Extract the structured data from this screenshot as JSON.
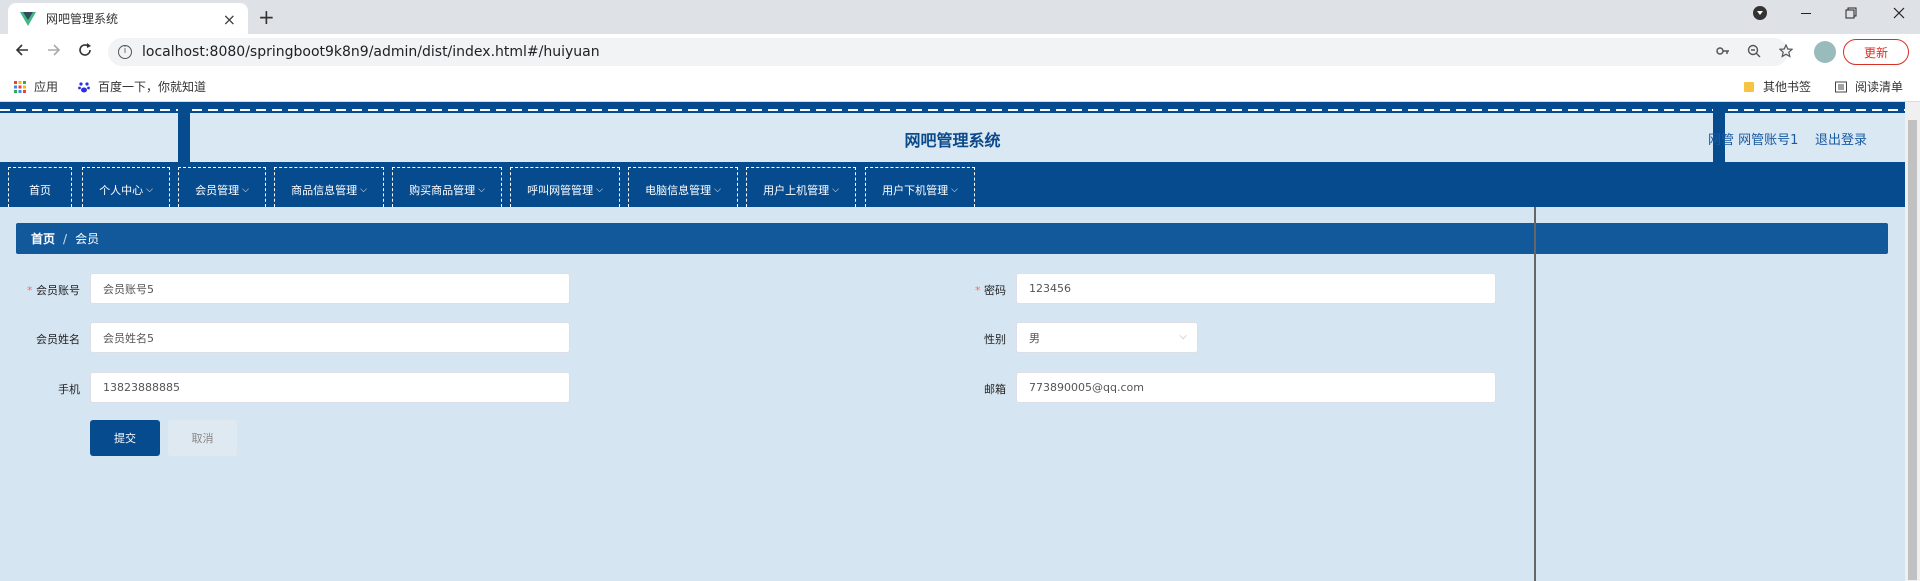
{
  "browser": {
    "tab_title": "网吧管理系统",
    "tab_close": "×",
    "new_tab": "+",
    "url": "localhost:8080/springboot9k8n9/admin/dist/index.html#/huiyuan",
    "update_label": "更新",
    "bookmarks": {
      "apps": "应用",
      "baidu": "百度一下，你就知道",
      "other": "其他书签",
      "reading": "阅读清单"
    }
  },
  "header": {
    "title": "网吧管理系统",
    "account": "网管 网管账号1",
    "logout": "退出登录"
  },
  "menu": [
    {
      "label": "首页",
      "dropdown": false
    },
    {
      "label": "个人中心",
      "dropdown": true
    },
    {
      "label": "会员管理",
      "dropdown": true
    },
    {
      "label": "商品信息管理",
      "dropdown": true
    },
    {
      "label": "购买商品管理",
      "dropdown": true
    },
    {
      "label": "呼叫网管管理",
      "dropdown": true
    },
    {
      "label": "电脑信息管理",
      "dropdown": true
    },
    {
      "label": "用户上机管理",
      "dropdown": true
    },
    {
      "label": "用户下机管理",
      "dropdown": true
    }
  ],
  "breadcrumb": {
    "home": "首页",
    "separator": "/",
    "current": "会员"
  },
  "form": {
    "account_label": "会员账号",
    "account_value": "会员账号5",
    "password_label": "密码",
    "password_value": "123456",
    "name_label": "会员姓名",
    "name_value": "会员姓名5",
    "gender_label": "性别",
    "gender_value": "男",
    "phone_label": "手机",
    "phone_value": "13823888885",
    "email_label": "邮箱",
    "email_value": "773890005@qq.com",
    "submit": "提交",
    "cancel": "取消"
  },
  "colors": {
    "primary": "#074b8f",
    "background": "#d6e5f2",
    "breadcrumb": "#12599c",
    "required": "#f56c6c"
  }
}
